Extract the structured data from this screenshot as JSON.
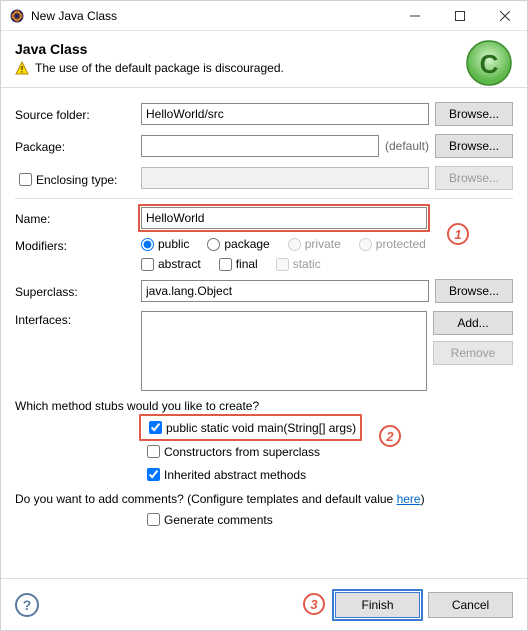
{
  "window": {
    "title": "New Java Class"
  },
  "header": {
    "title": "Java Class",
    "message": "The use of the default package is discouraged."
  },
  "fields": {
    "sourceFolder": {
      "label": "Source folder:",
      "value": "HelloWorld/src",
      "browse": "Browse..."
    },
    "package": {
      "label": "Package:",
      "value": "",
      "suffix": "(default)",
      "browse": "Browse..."
    },
    "enclosing": {
      "label": "Enclosing type:",
      "value": "",
      "browse": "Browse..."
    },
    "name": {
      "label": "Name:",
      "value": "HelloWorld"
    },
    "modifiers": {
      "label": "Modifiers:",
      "public": "public",
      "package": "package",
      "private": "private",
      "protected": "protected",
      "abstract": "abstract",
      "final": "final",
      "static": "static"
    },
    "superclass": {
      "label": "Superclass:",
      "value": "java.lang.Object",
      "browse": "Browse..."
    },
    "interfaces": {
      "label": "Interfaces:",
      "add": "Add...",
      "remove": "Remove"
    }
  },
  "stubs": {
    "question": "Which method stubs would you like to create?",
    "main": "public static void main(String[] args)",
    "constructors": "Constructors from superclass",
    "inherited": "Inherited abstract methods"
  },
  "comments": {
    "question_pre": "Do you want to add comments? (Configure templates and default value ",
    "link": "here",
    "question_post": ")",
    "generate": "Generate comments"
  },
  "footer": {
    "finish": "Finish",
    "cancel": "Cancel"
  },
  "annotations": {
    "n1": "1",
    "n2": "2",
    "n3": "3"
  }
}
